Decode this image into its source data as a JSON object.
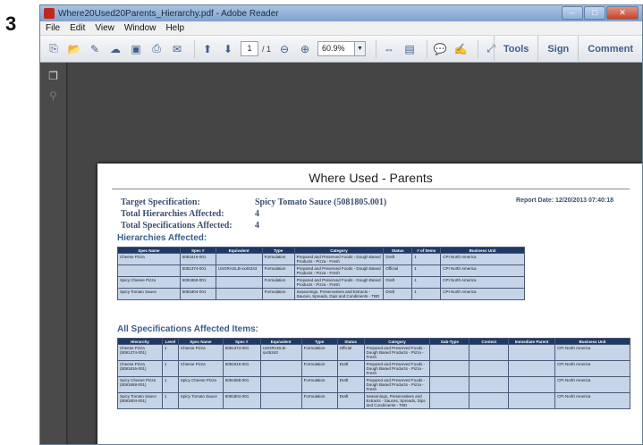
{
  "step_number": "3",
  "window": {
    "title": "Where20Used20Parents_Hierarchy.pdf - Adobe Reader",
    "controls": [
      "–",
      "□",
      "✕"
    ]
  },
  "menu": [
    "File",
    "Edit",
    "View",
    "Window",
    "Help"
  ],
  "toolbar": {
    "page_current": "1",
    "page_total": "/ 1",
    "zoom": "60.9%",
    "right_buttons": [
      "Tools",
      "Sign",
      "Comment"
    ]
  },
  "document": {
    "title": "Where Used - Parents",
    "target_label": "Target Specification:",
    "target_value": "Spicy Tomato Sauce (5081805.001)",
    "hier_label": "Total Hierarchies Affected:",
    "hier_value": "4",
    "spec_label": "Total Specifications Affected:",
    "spec_value": "4",
    "report_date": "Report Date: 12/20/2013 07:40:18",
    "hierarchies_heading": "Hierarchies Affected:",
    "all_specs_heading": "All Specifications Affected Items:"
  },
  "hierarchies_table": {
    "headers": [
      "Spec Name",
      "Spec #",
      "Equivalent",
      "Type",
      "Category",
      "Status",
      "# of Items",
      "Business Unit"
    ],
    "rows": [
      [
        "Cheese Pizza",
        "5081816-001",
        "",
        "Formulation",
        "Prepared and Preserved Foods - Dough Based Products - Pizza - Fresh",
        "Draft",
        "1",
        "CPI North America"
      ],
      [
        "",
        "5081374-001",
        "USORAGLB-sx45343",
        "Formulation",
        "Prepared and Preserved Foods - Dough Based Products - Pizza - Fresh",
        "Official",
        "1",
        "CPI North America"
      ],
      [
        "Spicy Cheese Pizza",
        "5081868-001",
        "",
        "Formulation",
        "Prepared and Preserved Foods - Dough Based Products - Pizza - Fresh",
        "Draft",
        "1",
        "CPI North America"
      ],
      [
        "Spicy Tomato Sauce",
        "5081804-001",
        "",
        "Formulation",
        "Seasonings, Preservatives and Extracts - Sauces, Spreads, Dips and Condiments - TBD",
        "Draft",
        "1",
        "CPI North America"
      ]
    ]
  },
  "all_specs_table": {
    "headers": [
      "Hierarchy",
      "Level",
      "Spec Name",
      "Spec #",
      "Equivalent",
      "Type",
      "Status",
      "Category",
      "Sub-Type",
      "Context",
      "Immediate Parent",
      "Business Unit"
    ],
    "rows": [
      [
        "Cheese Pizza (5081374-001)",
        "1",
        "Cheese Pizza",
        "5081374-001",
        "USORAGLB-sx45343",
        "Formulation",
        "Official",
        "Prepared and Preserved Foods - Dough Based Products - Pizza - Fresh",
        "",
        "",
        "",
        "CPI North America"
      ],
      [
        "Cheese Pizza (5081816-001)",
        "1",
        "Cheese Pizza",
        "5081816-001",
        "",
        "Formulation",
        "Draft",
        "Prepared and Preserved Foods - Dough Based Products - Pizza - Fresh",
        "",
        "",
        "",
        "CPI North America"
      ],
      [
        "Spicy Cheese Pizza (5081868-001)",
        "1",
        "Spicy Cheese Pizza",
        "5081868-001",
        "",
        "Formulation",
        "Draft",
        "Prepared and Preserved Foods - Dough Based Products - Pizza - Fresh",
        "",
        "",
        "",
        "CPI North America"
      ],
      [
        "Spicy Tomato Sauce (5081804-001)",
        "1",
        "Spicy Tomato Sauce",
        "5081804-001",
        "",
        "Formulation",
        "Draft",
        "Seasonings, Preservatives and Extracts - Sauces, Spreads, Dips and Condiments - TBD",
        "",
        "",
        "",
        "CPI North America"
      ]
    ]
  }
}
